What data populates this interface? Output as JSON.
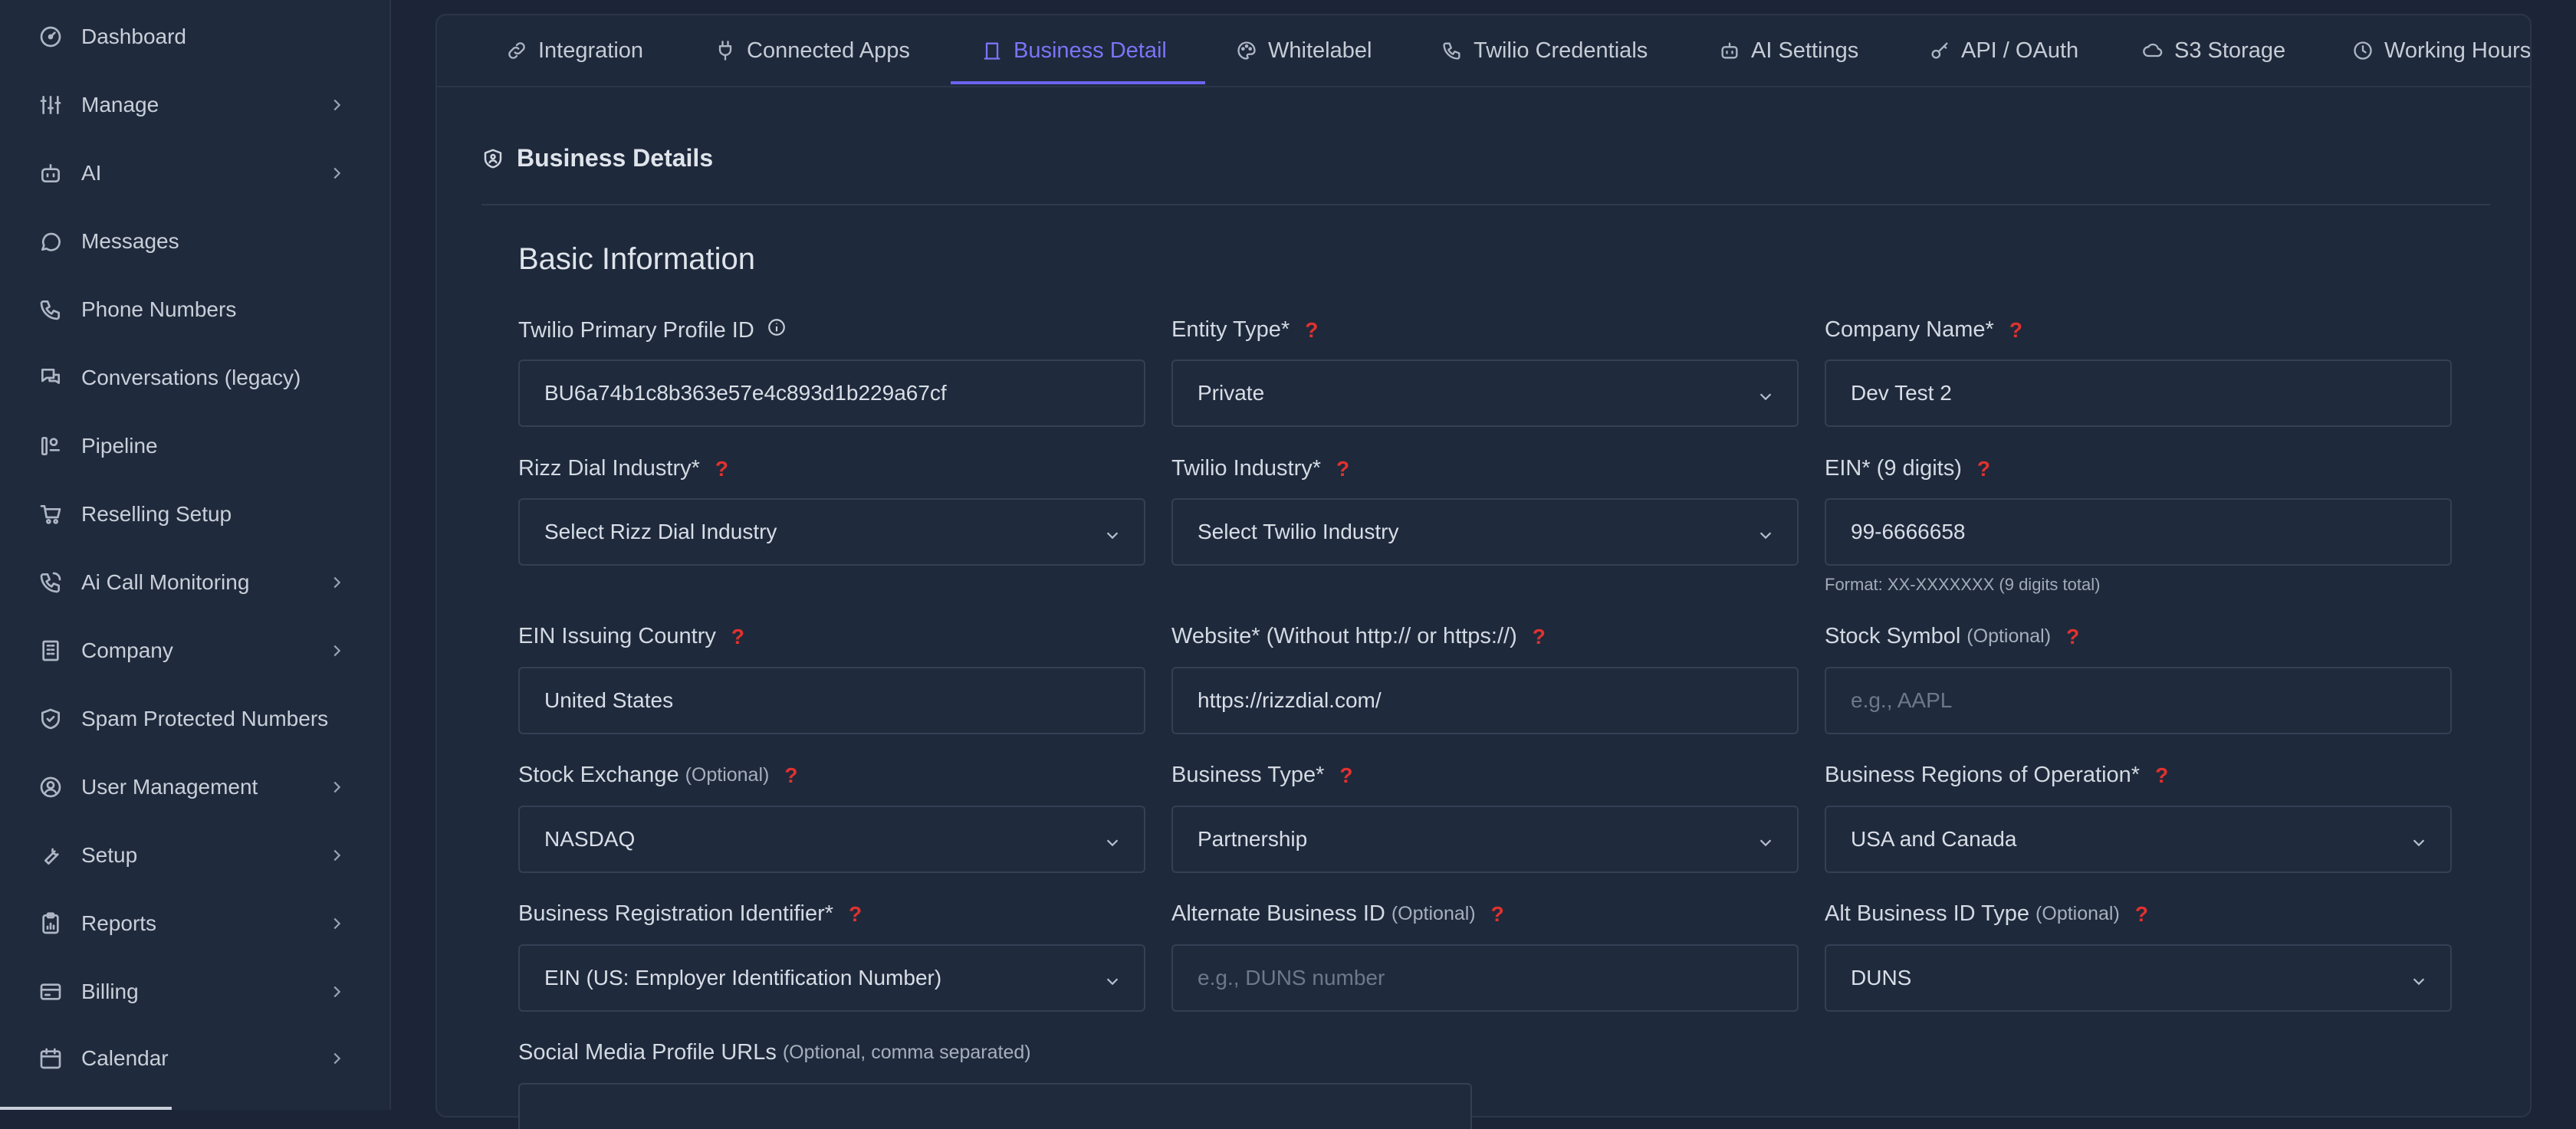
{
  "sidebar": {
    "items": [
      {
        "label": "Dashboard",
        "icon": "gauge-icon",
        "has_submenu": false
      },
      {
        "label": "Manage",
        "icon": "sliders-icon",
        "has_submenu": true
      },
      {
        "label": "AI",
        "icon": "bot-icon",
        "has_submenu": true
      },
      {
        "label": "Messages",
        "icon": "message-circle-icon",
        "has_submenu": false
      },
      {
        "label": "Phone Numbers",
        "icon": "phone-icon",
        "has_submenu": false
      },
      {
        "label": "Conversations (legacy)",
        "icon": "chat-bubbles-icon",
        "has_submenu": false
      },
      {
        "label": "Pipeline",
        "icon": "pipeline-icon",
        "has_submenu": false
      },
      {
        "label": "Reselling Setup",
        "icon": "cart-icon",
        "has_submenu": false
      },
      {
        "label": "Ai Call Monitoring",
        "icon": "phone-call-icon",
        "has_submenu": true
      },
      {
        "label": "Company",
        "icon": "building-icon",
        "has_submenu": true
      },
      {
        "label": "Spam Protected Numbers",
        "icon": "shield-check-icon",
        "has_submenu": false
      },
      {
        "label": "User Management",
        "icon": "user-circle-icon",
        "has_submenu": true
      },
      {
        "label": "Setup",
        "icon": "wrench-icon",
        "has_submenu": true
      },
      {
        "label": "Reports",
        "icon": "clipboard-icon",
        "has_submenu": true
      },
      {
        "label": "Billing",
        "icon": "credit-card-icon",
        "has_submenu": true
      },
      {
        "label": "Calendar",
        "icon": "calendar-icon",
        "has_submenu": true
      }
    ]
  },
  "tabs": [
    {
      "label": "Integration",
      "icon": "link-icon",
      "active": false
    },
    {
      "label": "Connected Apps",
      "icon": "plug-icon",
      "active": false
    },
    {
      "label": "Business Detail",
      "icon": "bank-icon",
      "active": true
    },
    {
      "label": "Whitelabel",
      "icon": "palette-icon",
      "active": false
    },
    {
      "label": "Twilio Credentials",
      "icon": "phone-icon",
      "active": false
    },
    {
      "label": "AI Settings",
      "icon": "bot-icon",
      "active": false
    },
    {
      "label": "API / OAuth",
      "icon": "key-icon",
      "active": false
    },
    {
      "label": "S3 Storage",
      "icon": "cloud-icon",
      "active": false
    },
    {
      "label": "Working Hours",
      "icon": "clock-icon",
      "active": false
    }
  ],
  "section": {
    "title": "Business Details",
    "icon": "shield-user-icon"
  },
  "basic": {
    "title": "Basic Information"
  },
  "help_mark": "?",
  "fields": {
    "twilio_profile_id": {
      "label": "Twilio Primary Profile ID",
      "value": "BU6a74b1c8b363e57e4c893d1b229a67cf"
    },
    "entity_type": {
      "label": "Entity Type*",
      "value": "Private"
    },
    "company_name": {
      "label": "Company Name*",
      "value": "Dev Test 2"
    },
    "rizz_industry": {
      "label": "Rizz Dial Industry*",
      "value": "Select Rizz Dial Industry"
    },
    "twilio_industry": {
      "label": "Twilio Industry*",
      "value": "Select Twilio Industry"
    },
    "ein": {
      "label": "EIN* (9 digits)",
      "value": "99-6666658",
      "hint": "Format: XX-XXXXXXX (9 digits total)"
    },
    "ein_country": {
      "label": "EIN Issuing Country",
      "value": "United States"
    },
    "website": {
      "label": "Website* (Without http:// or https://)",
      "value": "https://rizzdial.com/"
    },
    "stock_symbol": {
      "label": "Stock Symbol",
      "optional": "(Optional)",
      "placeholder": "e.g., AAPL"
    },
    "stock_exchange": {
      "label": "Stock Exchange",
      "optional": "(Optional)",
      "value": "NASDAQ"
    },
    "business_type": {
      "label": "Business Type*",
      "value": "Partnership"
    },
    "business_regions": {
      "label": "Business Regions of Operation*",
      "value": "USA and Canada"
    },
    "registration_identifier": {
      "label": "Business Registration Identifier*",
      "value": "EIN (US: Employer Identification Number)"
    },
    "alt_business_id": {
      "label": "Alternate Business ID",
      "optional": "(Optional)",
      "placeholder": "e.g., DUNS number"
    },
    "alt_business_id_type": {
      "label": "Alt Business ID Type",
      "optional": "(Optional)",
      "value": "DUNS"
    },
    "social_media": {
      "label": "Social Media Profile URLs",
      "optional": "(Optional, comma separated)"
    }
  }
}
